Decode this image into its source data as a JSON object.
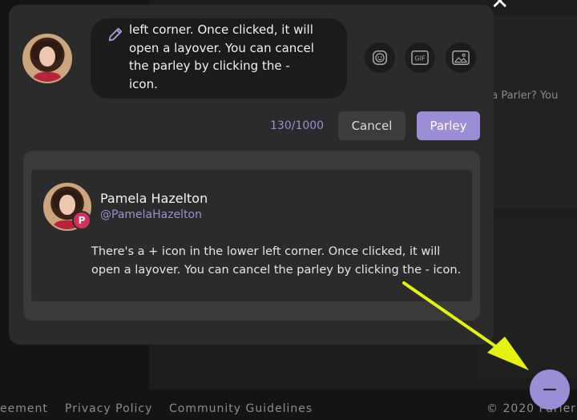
{
  "background": {
    "snippet": "via Parler? You",
    "close_glyph": "✕",
    "footer": {
      "agreement": "eement",
      "privacy": "Privacy Policy",
      "guidelines": "Community Guidelines",
      "copyright": "© 2020 Parler"
    }
  },
  "composer": {
    "text": "left corner. Once clicked, it will open a layover. You can cancel the parley by clicking the - icon.",
    "tools": [
      {
        "icon": "emoji-icon"
      },
      {
        "icon": "gif-icon",
        "label": "GIF"
      },
      {
        "icon": "image-icon"
      }
    ],
    "counter": "130/1000",
    "cancel_label": "Cancel",
    "submit_label": "Parley"
  },
  "quoted_post": {
    "name": "Pamela Hazelton",
    "handle": "@PamelaHazelton",
    "badge": "P",
    "text": "There's a + icon in the lower left corner. Once clicked, it will open a layover. You can cancel the parley by clicking the - icon."
  },
  "fab": {
    "symbol": "−"
  },
  "colors": {
    "accent": "#9b8ed6",
    "arrow": "#e4f20f",
    "modal": "#2b2b2b"
  }
}
